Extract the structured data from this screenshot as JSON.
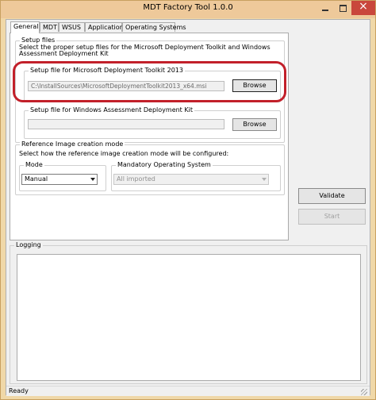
{
  "window": {
    "title": "MDT Factory Tool 1.0.0"
  },
  "tabs": [
    "General",
    "MDT",
    "WSUS",
    "Applications",
    "Operating Systems"
  ],
  "setup_files": {
    "title": "Setup files",
    "description_line1": "Select the proper setup files for the Microsoft Deployment Toolkit and Windows",
    "description_line2": "Assessment Deployment Kit",
    "mdt": {
      "title": "Setup file for Microsoft Deployment Toolkit 2013",
      "path": "C:\\InstallSources\\MicrosoftDeploymentToolkit2013_x64.msi",
      "browse_label": "Browse"
    },
    "adk": {
      "title": "Setup file for Windows Assessment Deployment Kit",
      "path": "",
      "browse_label": "Browse"
    }
  },
  "creation_mode": {
    "title": "Reference Image creation mode",
    "description": "Select how the reference image creation mode will be configured:",
    "mode": {
      "title": "Mode",
      "selected": "Manual"
    },
    "mandatory_os": {
      "title": "Mandatory Operating System",
      "selected": "All imported"
    }
  },
  "actions": {
    "validate_label": "Validate",
    "start_label": "Start"
  },
  "logging": {
    "title": "Logging"
  },
  "status": {
    "text": "Ready"
  },
  "colors": {
    "highlight": "#c2202a",
    "close_button": "#c9473c",
    "title_bar": "#eec99a"
  }
}
